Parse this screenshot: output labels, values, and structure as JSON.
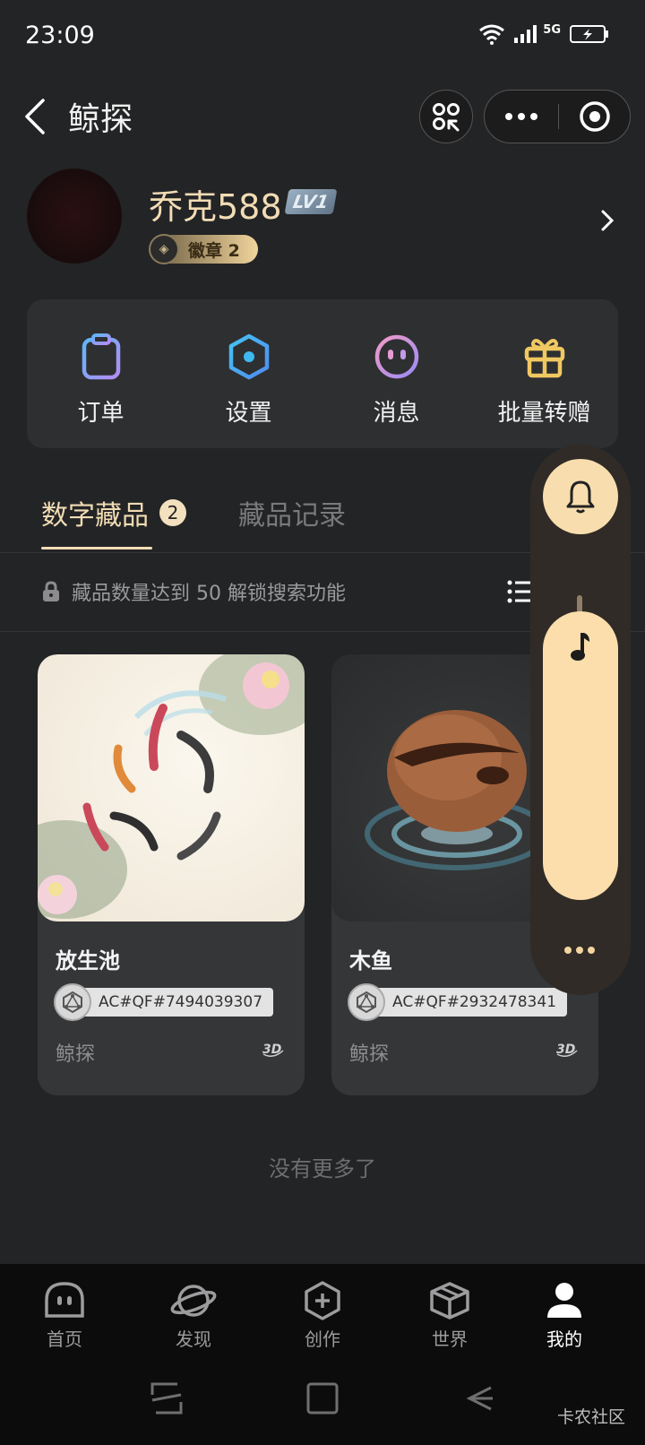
{
  "status_bar": {
    "time": "23:09",
    "network": "5G"
  },
  "header": {
    "title": "鲸探"
  },
  "profile": {
    "username": "乔克588",
    "level": "LV1",
    "badge_label": "徽章 2"
  },
  "menu": [
    {
      "label": "订单",
      "icon": "order-clipboard-icon"
    },
    {
      "label": "设置",
      "icon": "settings-hexagon-icon"
    },
    {
      "label": "消息",
      "icon": "message-face-icon"
    },
    {
      "label": "批量转赠",
      "icon": "gift-icon"
    }
  ],
  "tabs": {
    "active_label": "数字藏品",
    "active_count": "2",
    "inactive_label": "藏品记录"
  },
  "lock_notice": "藏品数量达到 50 解锁搜索功能",
  "cards": [
    {
      "title": "放生池",
      "chain_id": "AC#QF#7494039307",
      "brand": "鲸探"
    },
    {
      "title": "木鱼",
      "chain_id": "AC#QF#2932478341",
      "brand": "鲸探"
    }
  ],
  "no_more": "没有更多了",
  "bottom_nav": [
    {
      "label": "首页",
      "icon": "home-face-icon"
    },
    {
      "label": "发现",
      "icon": "planet-icon"
    },
    {
      "label": "创作",
      "icon": "create-plus-icon"
    },
    {
      "label": "世界",
      "icon": "cube-box-icon"
    },
    {
      "label": "我的",
      "icon": "user-icon",
      "active": true
    }
  ],
  "watermark": "卡农社区",
  "colors": {
    "accent_gold": "#f1dcb4",
    "background": "#232426",
    "panel_cream": "#fbdeab"
  }
}
